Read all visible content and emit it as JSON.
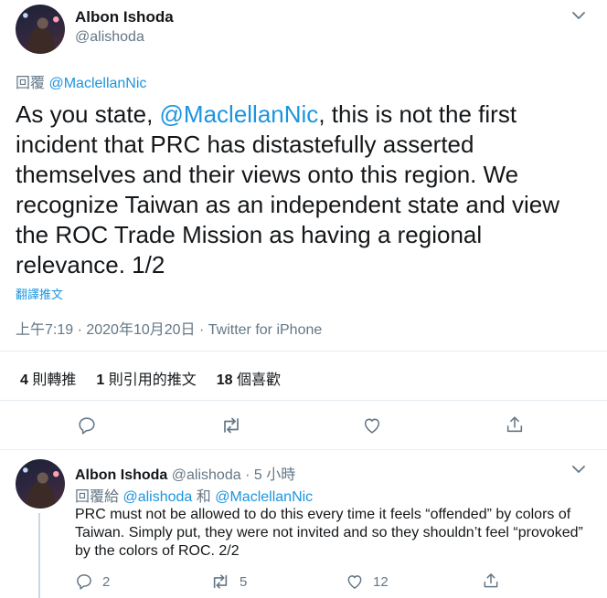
{
  "main_tweet": {
    "author_name": "Albon Ishoda",
    "author_handle": "@alishoda",
    "reply_prefix": "回覆",
    "reply_to": "@MaclellanNic",
    "text_before": "As you state, ",
    "text_mention": "@MaclellanNic",
    "text_after": ", this is not the first incident that PRC has distastefully asserted themselves and their views onto this region. We recognize Taiwan as an independent state and view the ROC Trade Mission as having a regional relevance. 1/2",
    "translate_label": "翻譯推文",
    "timestamp": "上午7:19 · 2020年10月20日 · Twitter for iPhone",
    "stats": {
      "retweets_count": "4",
      "retweets_label": "則轉推",
      "quotes_count": "1",
      "quotes_label": "則引用的推文",
      "likes_count": "18",
      "likes_label": "個喜歡"
    }
  },
  "reply_tweet": {
    "author_name": "Albon Ishoda",
    "author_handle": "@alishoda",
    "dot": "·",
    "time_ago": "5 小時",
    "reply_prefix": "回覆給",
    "reply_to_1": "@alishoda",
    "conj": "和",
    "reply_to_2": "@MaclellanNic",
    "text": "PRC must not be allowed to do this every time it feels “offended” by colors of Taiwan. Simply put, they were not invited and so they shouldn’t feel “provoked” by the colors of ROC. 2/2",
    "replies_count": "2",
    "retweets_count": "5",
    "likes_count": "12"
  },
  "colors": {
    "accent": "#1b95e0",
    "muted": "#657786",
    "text": "#14171a",
    "divider": "#e6ecf0"
  },
  "icons": [
    "chevron-down-icon",
    "reply-icon",
    "retweet-icon",
    "like-icon",
    "share-icon"
  ]
}
